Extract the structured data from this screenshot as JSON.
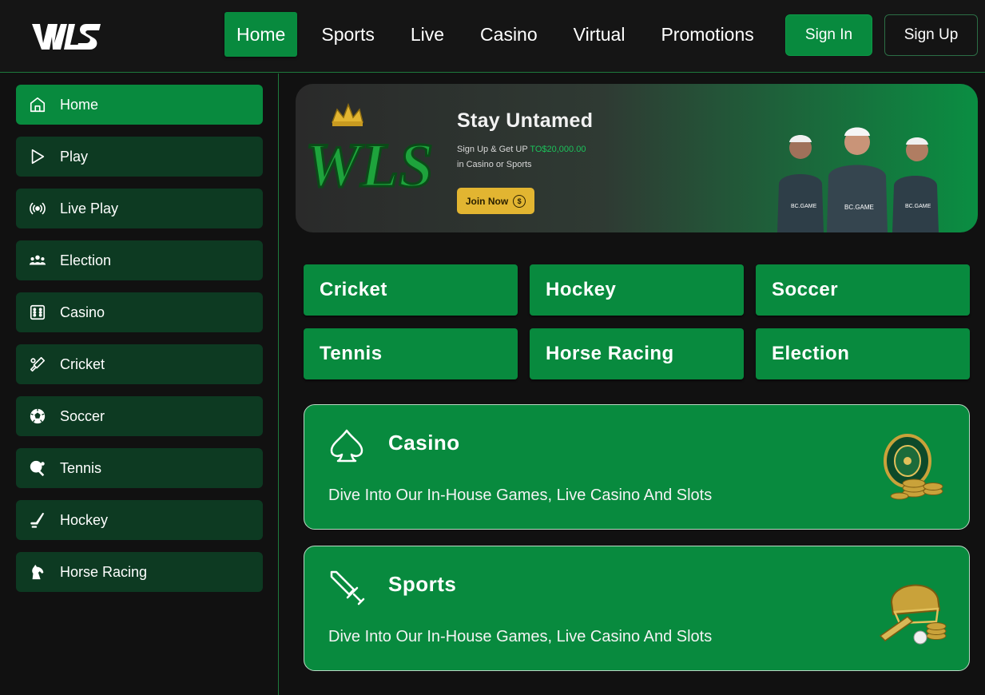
{
  "brand": {
    "logo_text": "WLS"
  },
  "nav": {
    "items": [
      {
        "label": "Home",
        "active": true
      },
      {
        "label": "Sports"
      },
      {
        "label": "Live"
      },
      {
        "label": "Casino"
      },
      {
        "label": "Virtual"
      },
      {
        "label": "Promotions"
      }
    ],
    "sign_in": "Sign In",
    "sign_up": "Sign Up"
  },
  "sidebar": {
    "items": [
      {
        "label": "Home",
        "icon": "home-icon",
        "active": true
      },
      {
        "label": "Play",
        "icon": "play-icon"
      },
      {
        "label": "Live Play",
        "icon": "broadcast-icon"
      },
      {
        "label": "Election",
        "icon": "people-icon"
      },
      {
        "label": "Casino",
        "icon": "dice-icon"
      },
      {
        "label": "Cricket",
        "icon": "cricket-bat-icon"
      },
      {
        "label": "Soccer",
        "icon": "soccer-ball-icon"
      },
      {
        "label": "Tennis",
        "icon": "table-tennis-icon"
      },
      {
        "label": "Hockey",
        "icon": "hockey-stick-icon"
      },
      {
        "label": "Horse Racing",
        "icon": "horse-head-icon"
      }
    ]
  },
  "banner": {
    "logo_text": "WLS",
    "title": "Stay Untamed",
    "sub_line1_prefix": "Sign Up & Get UP ",
    "sub_line1_highlight": "TO$20,000.00",
    "sub_line2": "in Casino or Sports",
    "cta": "Join Now",
    "cta_icon": "$",
    "jersey_text": "BC.GAME"
  },
  "tiles": [
    {
      "label": "Cricket"
    },
    {
      "label": "Hockey"
    },
    {
      "label": "Soccer"
    },
    {
      "label": "Tennis"
    },
    {
      "label": "Horse Racing"
    },
    {
      "label": "Election"
    }
  ],
  "cards": [
    {
      "title": "Casino",
      "description": "Dive Into Our In-House Games, Live Casino And Slots",
      "icon": "spade-icon",
      "art": "roulette-chips-icon"
    },
    {
      "title": "Sports",
      "description": "Dive Into Our In-House Games, Live Casino And Slots",
      "icon": "sword-icon",
      "art": "cricket-helmet-icon"
    }
  ],
  "colors": {
    "accent": "#088a3e",
    "sidebar_item": "#0d3a22",
    "background": "#111111",
    "gold": "#e2b531",
    "highlight": "#1bc15a"
  }
}
